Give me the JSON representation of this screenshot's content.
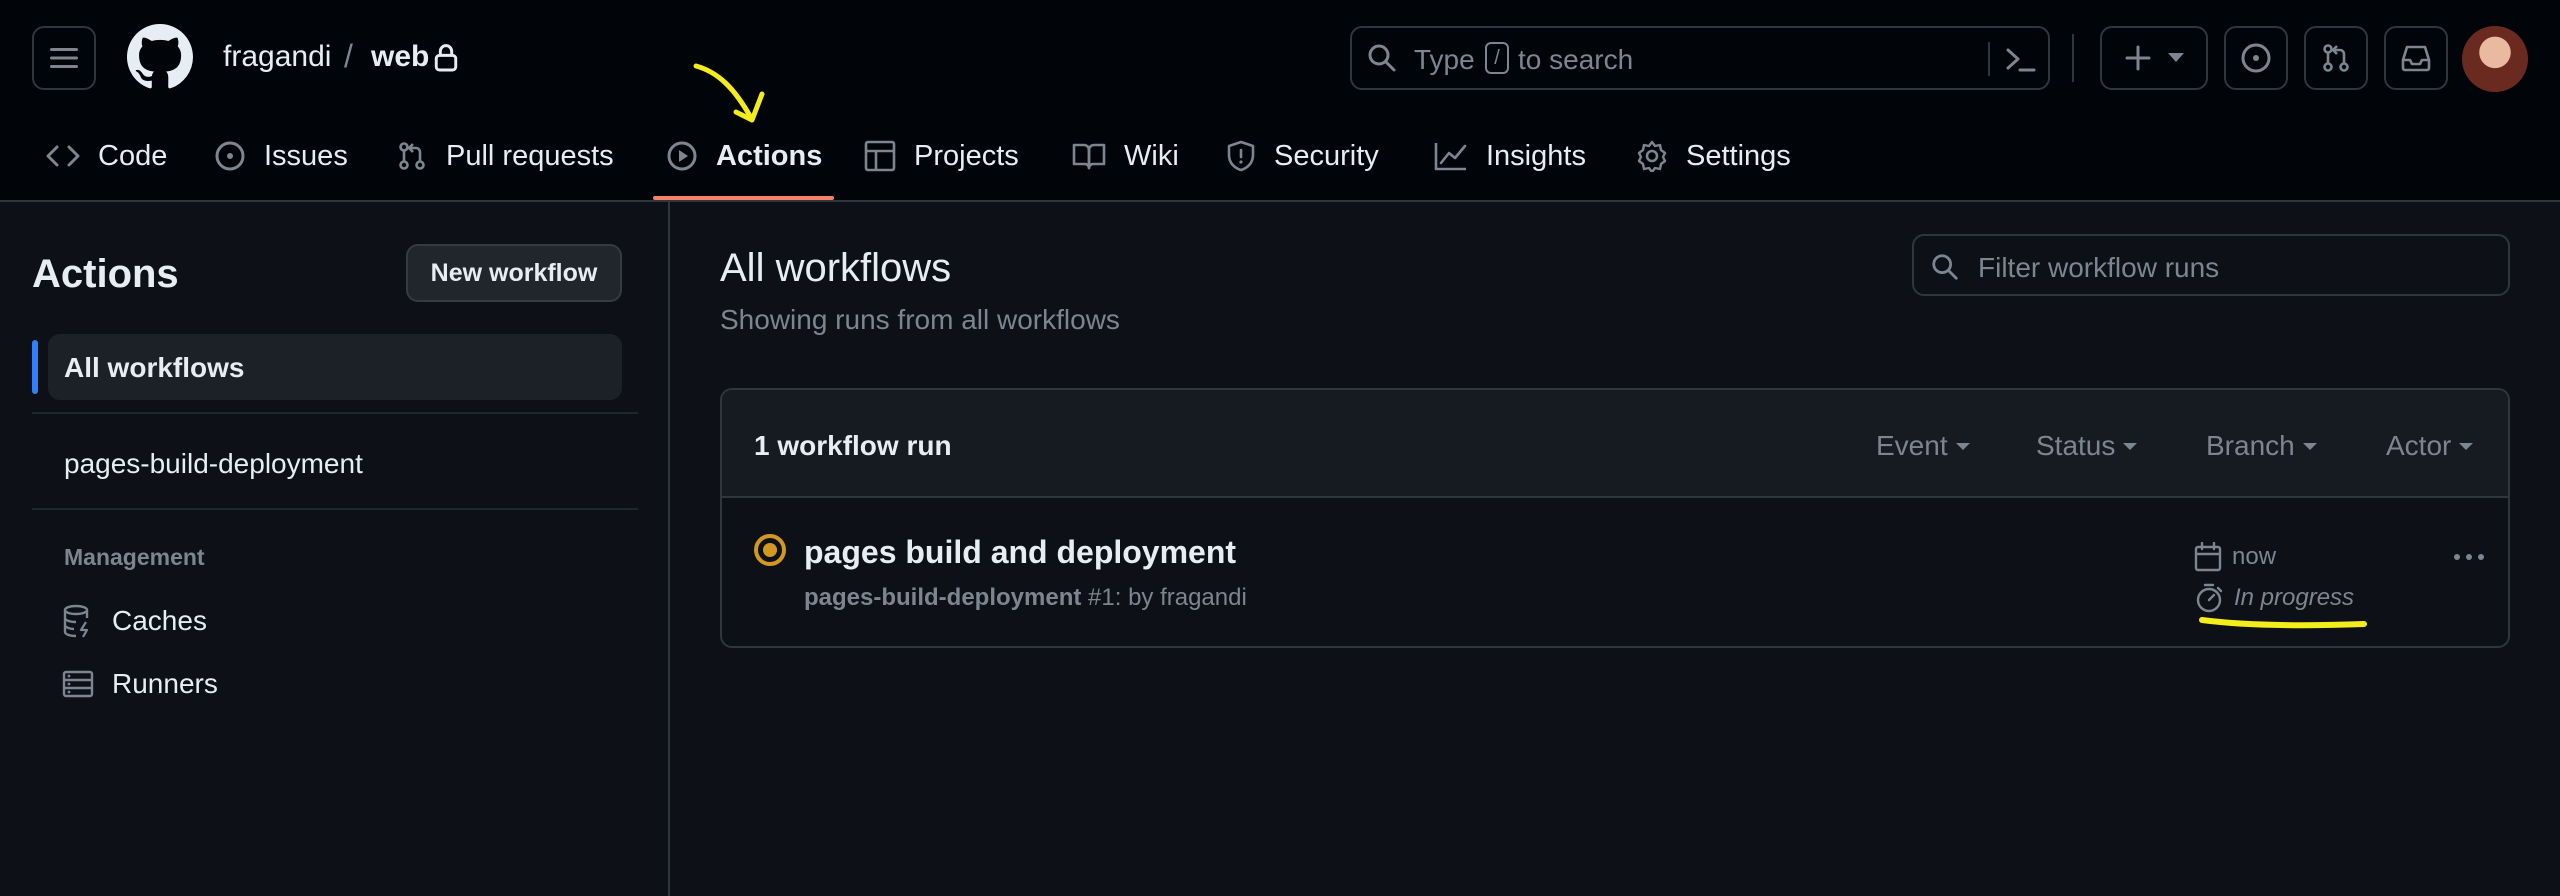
{
  "header": {
    "owner": "fragandi",
    "separator": "/",
    "repo": "web",
    "search": {
      "prefix": "Type",
      "key": "/",
      "suffix": "to search"
    }
  },
  "nav": {
    "items": [
      {
        "label": "Code",
        "icon": "code-icon"
      },
      {
        "label": "Issues",
        "icon": "issue-opened-icon"
      },
      {
        "label": "Pull requests",
        "icon": "git-pull-request-icon"
      },
      {
        "label": "Actions",
        "icon": "play-icon",
        "active": true
      },
      {
        "label": "Projects",
        "icon": "table-icon"
      },
      {
        "label": "Wiki",
        "icon": "book-icon"
      },
      {
        "label": "Security",
        "icon": "shield-icon"
      },
      {
        "label": "Insights",
        "icon": "graph-icon"
      },
      {
        "label": "Settings",
        "icon": "gear-icon"
      }
    ],
    "accent": "#f78166"
  },
  "sidebar": {
    "title": "Actions",
    "new_workflow_label": "New workflow",
    "all_workflows_label": "All workflows",
    "workflows": [
      "pages-build-deployment"
    ],
    "management_heading": "Management",
    "management_items": [
      {
        "label": "Caches",
        "icon": "database-icon"
      },
      {
        "label": "Runners",
        "icon": "server-icon"
      }
    ]
  },
  "main": {
    "title": "All workflows",
    "subtitle": "Showing runs from all workflows",
    "filter_placeholder": "Filter workflow runs",
    "run_count": "1 workflow run",
    "filters": [
      "Event",
      "Status",
      "Branch",
      "Actor"
    ],
    "runs": [
      {
        "title": "pages build and deployment",
        "workflow": "pages-build-deployment",
        "meta_rest": "#1: by fragandi",
        "when": "now",
        "duration": "In progress",
        "status_color": "#d29922"
      }
    ]
  },
  "annotation_color": "#f5ec1c"
}
